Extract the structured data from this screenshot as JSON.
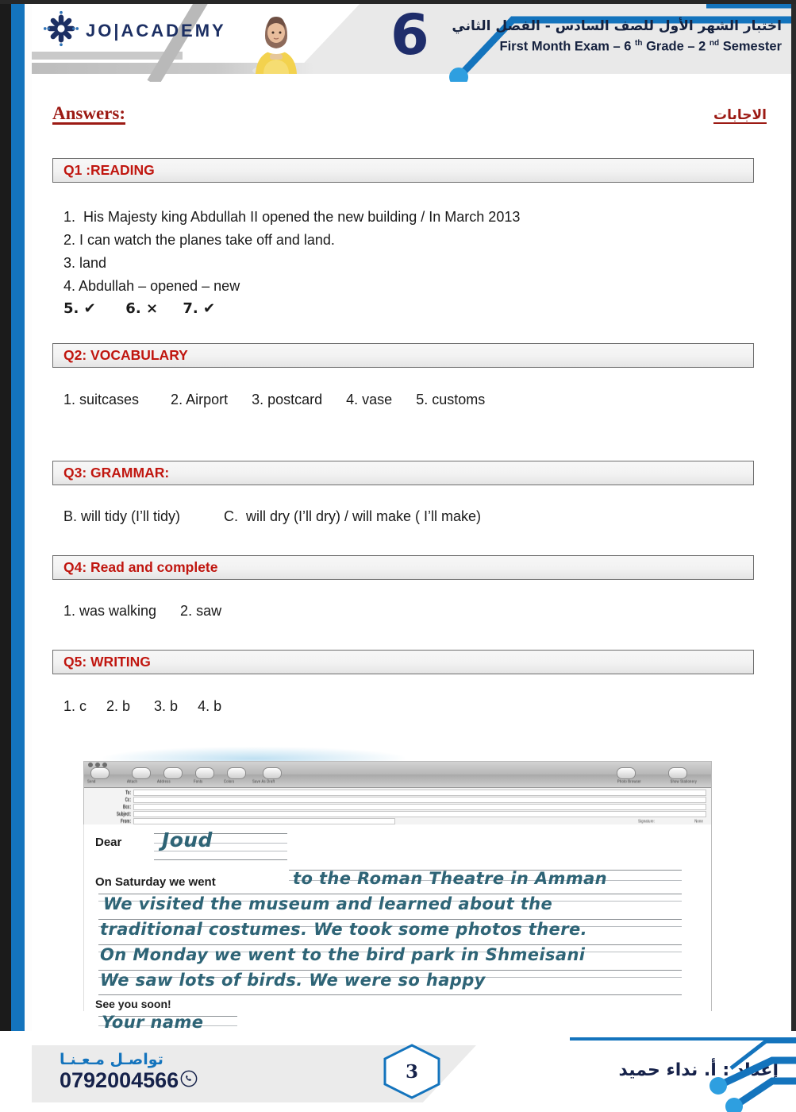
{
  "header": {
    "brand": "JO|ACADEMY",
    "logo_icon": "joacademy-star-logo",
    "grade_badge": "6",
    "title_ar": "اختبار الشهر  الأول للصف السادس - الفصل الثاني",
    "title_en_prefix": "First Month Exam – 6 ",
    "title_en_sup1": "th",
    "title_en_mid": " Grade – 2 ",
    "title_en_sup2": "nd",
    "title_en_suffix": " Semester",
    "avatar_alt": "teacher-photo"
  },
  "doc": {
    "answers_label_en": "Answers:",
    "answers_label_ar": "الاجابات"
  },
  "sections": [
    {
      "id": "q1",
      "heading": "Q1 :READING",
      "lines": [
        "1.  His Majesty king Abdullah II opened the new building / In March 2013",
        "2. I can watch the planes take off and land.",
        "3. land",
        "4. Abdullah – opened – new",
        "5. ✔      6. ×     7. ✔"
      ]
    },
    {
      "id": "q2",
      "heading": "Q2: VOCABULARY",
      "lines": [
        "1. suitcases        2. Airport      3. postcard      4. vase      5. customs"
      ]
    },
    {
      "id": "q3",
      "heading": "Q3: GRAMMAR:",
      "lines": [
        "B. will tidy (I’ll tidy)           C.  will dry (I’ll dry) / will make ( I’ll make)"
      ]
    },
    {
      "id": "q4",
      "heading": "Q4: Read and complete",
      "lines": [
        "1. was walking      2. saw"
      ]
    },
    {
      "id": "q5",
      "heading": "Q5: WRITING",
      "lines": [
        "1. c     2. b      3. b     4. b"
      ]
    }
  ],
  "email_mock": {
    "toolbar_buttons": [
      {
        "label": "Send",
        "icon": "send-icon"
      },
      {
        "label": "Attach",
        "icon": "paperclip-icon"
      },
      {
        "label": "Address",
        "icon": "address-book-icon"
      },
      {
        "label": "Fonts",
        "icon": "fonts-icon"
      },
      {
        "label": "Colors",
        "icon": "colors-icon"
      },
      {
        "label": "Save As Draft",
        "icon": "draft-icon"
      }
    ],
    "toolbar_right_buttons": [
      {
        "label": "Photo Browser",
        "icon": "photo-browser-icon"
      },
      {
        "label": "Show Stationery",
        "icon": "stationery-icon"
      }
    ],
    "fields": [
      {
        "label": "To:",
        "value": ""
      },
      {
        "label": "Cc:",
        "value": ""
      },
      {
        "label": "Bcc:",
        "value": ""
      },
      {
        "label": "Subject:",
        "value": ""
      },
      {
        "label": "From:",
        "value": ""
      }
    ],
    "signature_label": "Signature:",
    "signature_value": "None",
    "letter": {
      "salutation_printed": "Dear",
      "salutation_hand": "Joud",
      "line1_printed": "On Saturday we went",
      "line1_hand": "to the Roman Theatre in Amman",
      "line2_hand": "We visited the museum and learned about the",
      "line3_hand": "traditional costumes. We took some photos there.",
      "line4_hand": "On Monday we went to the bird park in Shmeisani",
      "line5_hand": "We saw lots of birds. We were so happy",
      "closing_printed": "See you soon!",
      "signoff_hand": "Your name"
    }
  },
  "footer": {
    "contact_ar": "تواصـل مـعـنـا",
    "phone": "0792004566",
    "whatsapp_icon": "whatsapp-icon",
    "page_number": "3",
    "prepared_by_ar": "إعداد : أ. نداء حميد"
  },
  "colors": {
    "brand_navy": "#1c2f63",
    "brand_blue": "#1474bd",
    "accent_red": "#c0160f",
    "answers_red": "#9c1a14",
    "hand_ink": "#2e6476",
    "bar_gray": "#f2f2f2"
  }
}
